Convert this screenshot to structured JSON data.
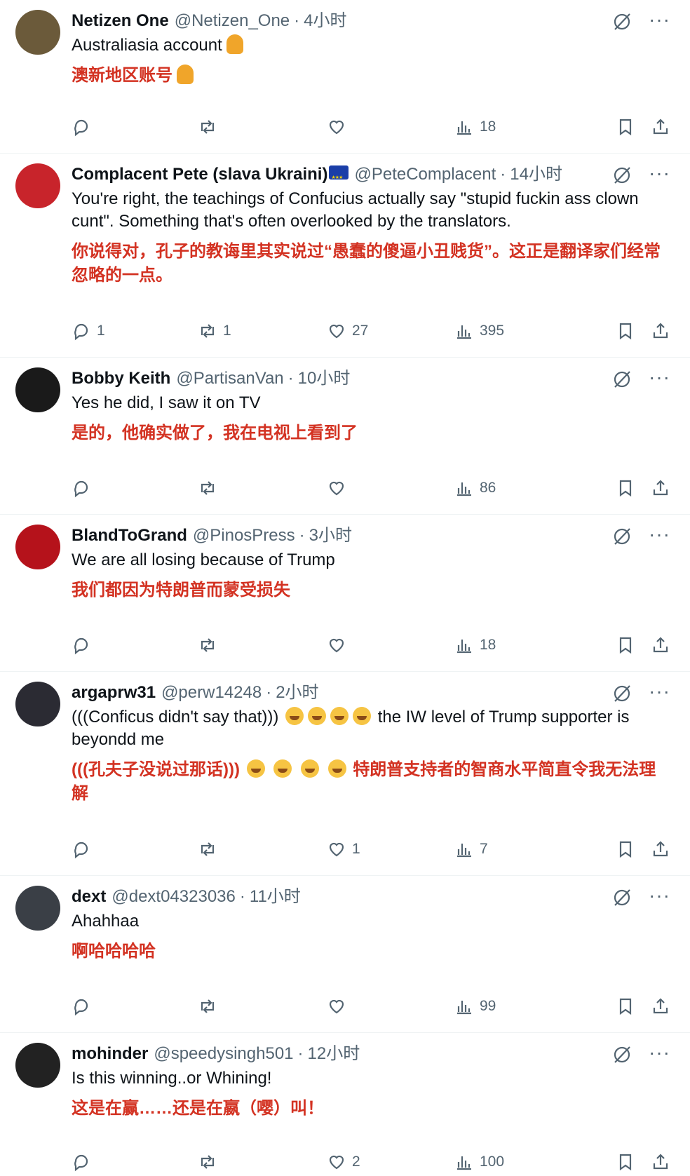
{
  "tweets": [
    {
      "name": "Netizen One",
      "handle": "@Netizen_One",
      "dot": "·",
      "time": "4小时",
      "text_en": "Australiasia account",
      "text_zh": "澳新地区账号",
      "replies": "",
      "retweets": "",
      "likes": "",
      "views": "18",
      "avatar_color": "#6b5a3a"
    },
    {
      "name": "Complacent Pete (slava Ukraini)",
      "handle": "@PeteComplacent",
      "dot": "·",
      "time": "14小时",
      "text_en": "You're right, the teachings of Confucius actually say \"stupid fuckin ass clown cunt\". Something that's often overlooked by the translators.",
      "text_zh": "你说得对，孔子的教诲里其实说过“愚蠢的傻逼小丑贱货”。这正是翻译家们经常忽略的一点。",
      "replies": "1",
      "retweets": "1",
      "likes": "27",
      "views": "395",
      "avatar_color": "#c8242b"
    },
    {
      "name": "Bobby Keith",
      "handle": "@PartisanVan",
      "dot": "·",
      "time": "10小时",
      "text_en": "Yes he did, I saw it on TV",
      "text_zh": "是的，他确实做了，我在电视上看到了",
      "replies": "",
      "retweets": "",
      "likes": "",
      "views": "86",
      "avatar_color": "#1a1a1a"
    },
    {
      "name": "BlandToGrand",
      "handle": "@PinosPress",
      "dot": "·",
      "time": "3小时",
      "text_en": "We are all losing because of Trump",
      "text_zh": "我们都因为特朗普而蒙受损失",
      "replies": "",
      "retweets": "",
      "likes": "",
      "views": "18",
      "avatar_color": "#b5121b"
    },
    {
      "name": "argaprw31",
      "handle": "@perw14248",
      "dot": "·",
      "time": "2小时",
      "text_en_a": "(((Conficus didn't say that)))",
      "text_en_b": "the IW level of Trump supporter is beyondd me",
      "text_zh_a": "(((孔夫子没说过那话)))",
      "text_zh_b": "特朗普支持者的智商水平简直令我无法理解",
      "replies": "",
      "retweets": "",
      "likes": "1",
      "views": "7",
      "avatar_color": "#2b2b33"
    },
    {
      "name": "dext",
      "handle": "@dext04323036",
      "dot": "·",
      "time": "11小时",
      "text_en": "Ahahhaa",
      "text_zh": "啊哈哈哈哈",
      "replies": "",
      "retweets": "",
      "likes": "",
      "views": "99",
      "avatar_color": "#3a3f46"
    },
    {
      "name": "mohinder",
      "handle": "@speedysingh501",
      "dot": "·",
      "time": "12小时",
      "text_en": "Is this winning..or Whining!",
      "text_zh": "这是在赢……还是在嬴（嘤）叫！",
      "replies": "",
      "retweets": "",
      "likes": "2",
      "views": "100",
      "avatar_color": "#222222"
    }
  ],
  "menu": {
    "more": "···"
  },
  "icons": {
    "reply": "reply-icon",
    "retweet": "retweet-icon",
    "like": "heart-icon",
    "views": "views-icon",
    "bookmark": "bookmark-icon",
    "share": "share-icon",
    "grok": "grok-icon"
  }
}
